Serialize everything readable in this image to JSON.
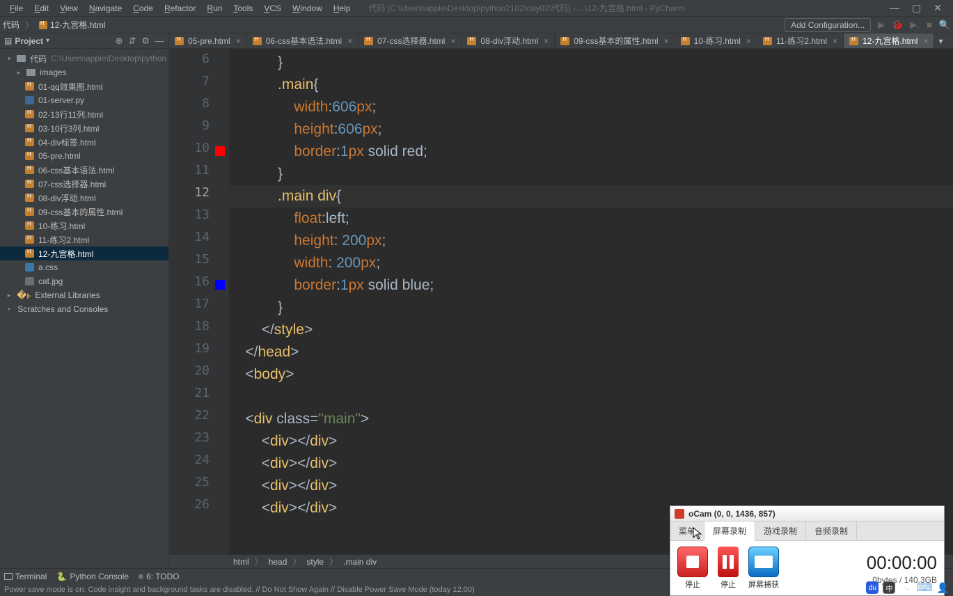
{
  "window_title": "代码 [C:\\Users\\apple\\Desktop\\python2102\\day02\\代码] - ...\\12-九宫格.html - PyCharm",
  "menu": [
    "File",
    "Edit",
    "View",
    "Navigate",
    "Code",
    "Refactor",
    "Run",
    "Tools",
    "VCS",
    "Window",
    "Help"
  ],
  "nav": {
    "root": "代码",
    "current_file": "12-九宫格.html",
    "add_config": "Add Configuration..."
  },
  "project": {
    "label": "Project",
    "root_name": "代码",
    "root_path": "C:\\Users\\apple\\Desktop\\python",
    "images_folder": "images",
    "files": [
      "01-qq效果图.html",
      "01-server.py",
      "02-13行11列.html",
      "03-10行3列.html",
      "04-div标签.html",
      "05-pre.html",
      "06-css基本语法.html",
      "07-css选择器.html",
      "08-div浮动.html",
      "09-css基本的属性.html",
      "10-练习.html",
      "11-练习2.html",
      "12-九宫格.html",
      "a.css",
      "cat.jpg"
    ],
    "external": "External Libraries",
    "scratches": "Scratches and Consoles"
  },
  "tabs": [
    "05-pre.html",
    "06-css基本语法.html",
    "07-css选择器.html",
    "08-div浮动.html",
    "09-css基本的属性.html",
    "10-练习.html",
    "11-练习2.html",
    "12-九宫格.html"
  ],
  "active_tab": 7,
  "gutter_start": 6,
  "highlighted_line": 12,
  "red_line": 10,
  "blue_line": 16,
  "code_lines_html": [
    "            <span class='punct'>}</span>",
    "            <span class='sel'>.main</span><span class='punct'>{</span>",
    "                <span class='kw'>width</span><span class='punct'>:</span><span class='num'>606</span><span class='kw'>px</span><span class='punct'>;</span>",
    "                <span class='kw'>height</span><span class='punct'>:</span><span class='num'>606</span><span class='kw'>px</span><span class='punct'>;</span>",
    "                <span class='kw'>border</span><span class='punct'>:</span><span class='num'>1</span><span class='kw'>px</span> <span class='op'>solid</span> <span class='op'>red</span><span class='punct'>;</span>",
    "            <span class='punct'>}</span>",
    "            <span class='sel'>.main</span> <span class='sel'>div</span><span class='punct'>{</span>",
    "                <span class='kw'>float</span><span class='punct'>:</span><span class='op'>left</span><span class='punct'>;</span>",
    "                <span class='kw'>height</span><span class='punct'>:</span> <span class='num'>200</span><span class='kw'>px</span><span class='punct'>;</span>",
    "                <span class='kw'>width</span><span class='punct'>:</span> <span class='num'>200</span><span class='kw'>px</span><span class='punct'>;</span>",
    "                <span class='kw'>border</span><span class='punct'>:</span><span class='num'>1</span><span class='kw'>px</span> <span class='op'>solid</span> <span class='op'>blue</span><span class='punct'>;</span>",
    "            <span class='punct'>}</span>",
    "        <span class='punct'>&lt;/</span><span class='tag'>style</span><span class='punct'>&gt;</span>",
    "    <span class='punct'>&lt;/</span><span class='tag'>head</span><span class='punct'>&gt;</span>",
    "    <span class='punct'>&lt;</span><span class='tag'>body</span><span class='punct'>&gt;</span>",
    "",
    "    <span class='punct'>&lt;</span><span class='tag'>div </span><span class='op'>class</span><span class='punct'>=</span><span class='str'>\"main\"</span><span class='punct'>&gt;</span>",
    "        <span class='punct'>&lt;</span><span class='tag'>div</span><span class='punct'>&gt;&lt;/</span><span class='tag'>div</span><span class='punct'>&gt;</span>",
    "        <span class='punct'>&lt;</span><span class='tag'>div</span><span class='punct'>&gt;&lt;/</span><span class='tag'>div</span><span class='punct'>&gt;</span>",
    "        <span class='punct'>&lt;</span><span class='tag'>div</span><span class='punct'>&gt;&lt;/</span><span class='tag'>div</span><span class='punct'>&gt;</span>",
    "        <span class='punct'>&lt;</span><span class='tag'>div</span><span class='punct'>&gt;&lt;/</span><span class='tag'>div</span><span class='punct'>&gt;</span>"
  ],
  "breadcrumb": [
    "html",
    "head",
    "style",
    ".main div"
  ],
  "statusbar": {
    "terminal": "Terminal",
    "pyconsole": "Python Console",
    "todo": "6: TODO"
  },
  "bottom_msg": "Power save mode is on: Code insight and background tasks are disabled. // Do Not Show Again // Disable Power Save Mode (today 12:00)",
  "ocam": {
    "title": "oCam (0, 0, 1436, 857)",
    "tabs": [
      "菜单",
      "屏幕录制",
      "游戏录制",
      "音频录制"
    ],
    "active_tab": 1,
    "btn_stop_big": "停止",
    "btn_stop": "停止",
    "btn_pause": "停止",
    "btn_capture": "屏幕捕获",
    "time": "00:00:00",
    "size": "0bytes / 140.3GB"
  },
  "tray": {
    "zh": "中"
  }
}
